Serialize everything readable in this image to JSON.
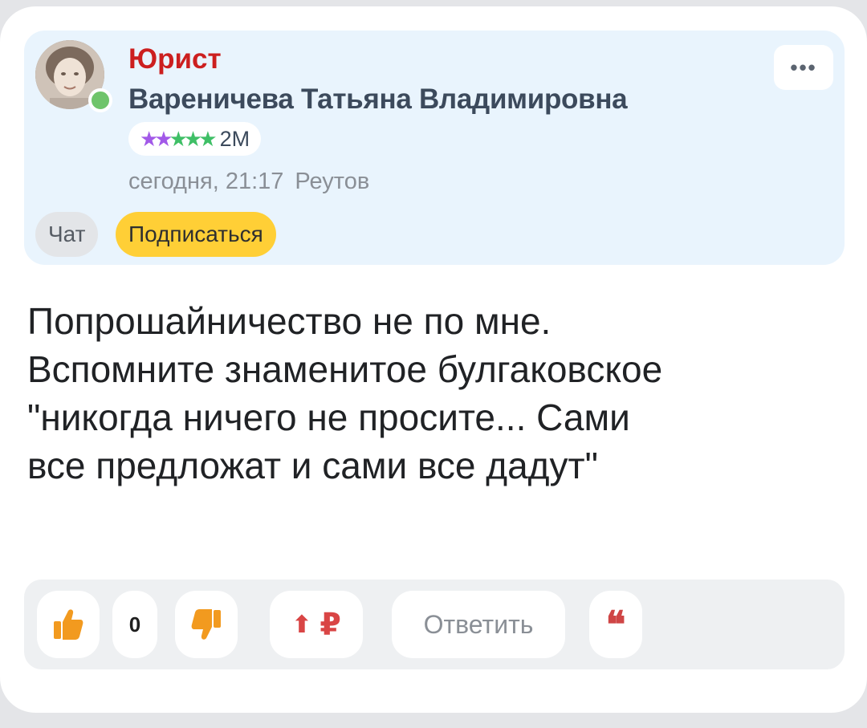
{
  "author": {
    "role": "Юрист",
    "name": "Вареничева Татьяна Владимировна",
    "rating_count": "2M",
    "rating_stars": "★★★★★",
    "date": "сегодня, 21:17",
    "city": "Реутов",
    "online": true,
    "chat_label": "Чат",
    "subscribe_label": "Подписаться",
    "more_label": "•••"
  },
  "post": {
    "lines": [
      "Попрошайничество не по мне.",
      "Вспомните знаменитое булгаковское",
      "\"никогда ничего не просите... Сами",
      "все предложат и сами все дадут\""
    ]
  },
  "actions": {
    "votes": "0",
    "reply_label": "Ответить",
    "tip_arrow": "⬆",
    "tip_currency": "₽",
    "quote_symbol": "66"
  },
  "colors": {
    "accent_yellow": "#ffcf36",
    "role_red": "#cc1f1f",
    "author_bg": "#e9f4fd",
    "online_green": "#6fc46a",
    "like_orange": "#f29a1f"
  }
}
